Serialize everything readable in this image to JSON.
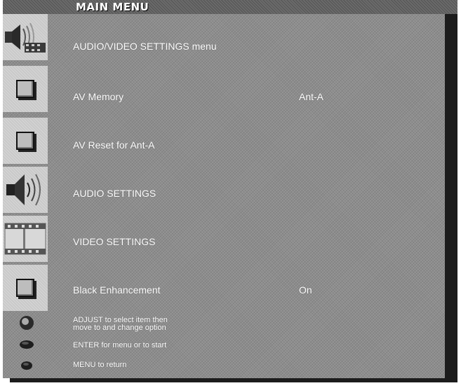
{
  "menu": {
    "title": "MAIN MENU",
    "items": [
      {
        "label": "AUDIO/VIDEO SETTINGS menu",
        "value": "",
        "icon": "speaker-film-icon"
      },
      {
        "label": "AV Memory",
        "value": "Ant-A",
        "icon": "square-icon"
      },
      {
        "label": "AV Reset for Ant-A",
        "value": "",
        "icon": "square-icon"
      },
      {
        "label": "AUDIO SETTINGS",
        "value": "",
        "icon": "speaker-icon"
      },
      {
        "label": "VIDEO SETTINGS",
        "value": "",
        "icon": "film-strip-icon"
      },
      {
        "label": "Black Enhancement",
        "value": "On",
        "icon": "square-icon"
      }
    ]
  },
  "help": {
    "adjust_line1": "ADJUST to select item then",
    "adjust_line2": "move to and change option",
    "enter": "ENTER for menu or to start",
    "menu_return": "MENU to return"
  },
  "colors": {
    "panel": "#8d8d8d",
    "highlight": "#c9c9c9",
    "text": "#ffffff",
    "shadow": "#1c1c1c"
  }
}
